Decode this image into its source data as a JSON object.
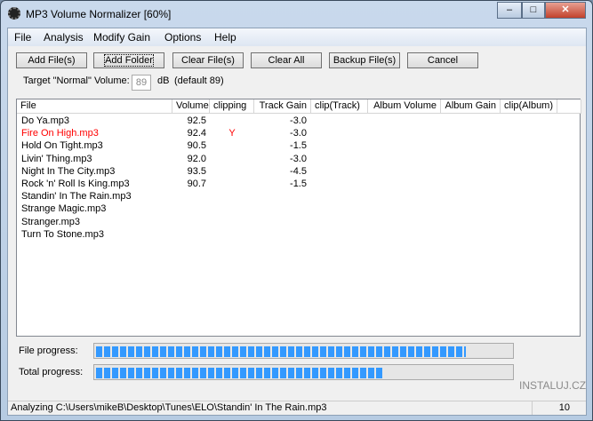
{
  "window": {
    "title": "MP3 Volume Normalizer [60%]"
  },
  "menu": [
    "File",
    "Analysis",
    "Modify Gain",
    "Options",
    "Help"
  ],
  "toolbar": {
    "add_files": "Add File(s)",
    "add_folder": "Add Folder",
    "clear_files": "Clear File(s)",
    "clear_all": "Clear All",
    "backup_files": "Backup File(s)",
    "cancel": "Cancel"
  },
  "target": {
    "label": "Target \"Normal\" Volume:",
    "value": "89",
    "unit": "dB",
    "default": "(default 89)"
  },
  "columns": [
    "File",
    "Volume",
    "clipping",
    "Track Gain",
    "clip(Track)",
    "Album Volume",
    "Album Gain",
    "clip(Album)"
  ],
  "rows": [
    {
      "file": "Do Ya.mp3",
      "volume": "92.5",
      "clipping": "",
      "gain": "-3.0"
    },
    {
      "file": "Fire On High.mp3",
      "volume": "92.4",
      "clipping": "Y",
      "gain": "-3.0",
      "clip_color": "#ff0000"
    },
    {
      "file": "Hold On Tight.mp3",
      "volume": "90.5",
      "clipping": "",
      "gain": "-1.5"
    },
    {
      "file": "Livin' Thing.mp3",
      "volume": "92.0",
      "clipping": "",
      "gain": "-3.0"
    },
    {
      "file": "Night In The City.mp3",
      "volume": "93.5",
      "clipping": "",
      "gain": "-4.5"
    },
    {
      "file": "Rock 'n' Roll Is King.mp3",
      "volume": "90.7",
      "clipping": "",
      "gain": "-1.5"
    },
    {
      "file": "Standin' In The Rain.mp3",
      "volume": "",
      "clipping": "",
      "gain": ""
    },
    {
      "file": "Strange Magic.mp3",
      "volume": "",
      "clipping": "",
      "gain": ""
    },
    {
      "file": "Stranger.mp3",
      "volume": "",
      "clipping": "",
      "gain": ""
    },
    {
      "file": "Turn To Stone.mp3",
      "volume": "",
      "clipping": "",
      "gain": ""
    }
  ],
  "progress": {
    "file_label": "File progress:",
    "file_pct": 89,
    "total_label": "Total progress:",
    "total_pct": 69,
    "color": "#3399ff"
  },
  "status": {
    "text": "Analyzing C:\\Users\\mikeB\\Desktop\\Tunes\\ELO\\Standin' In The Rain.mp3",
    "count": "10"
  },
  "watermark": "INSTALUJ.CZ"
}
